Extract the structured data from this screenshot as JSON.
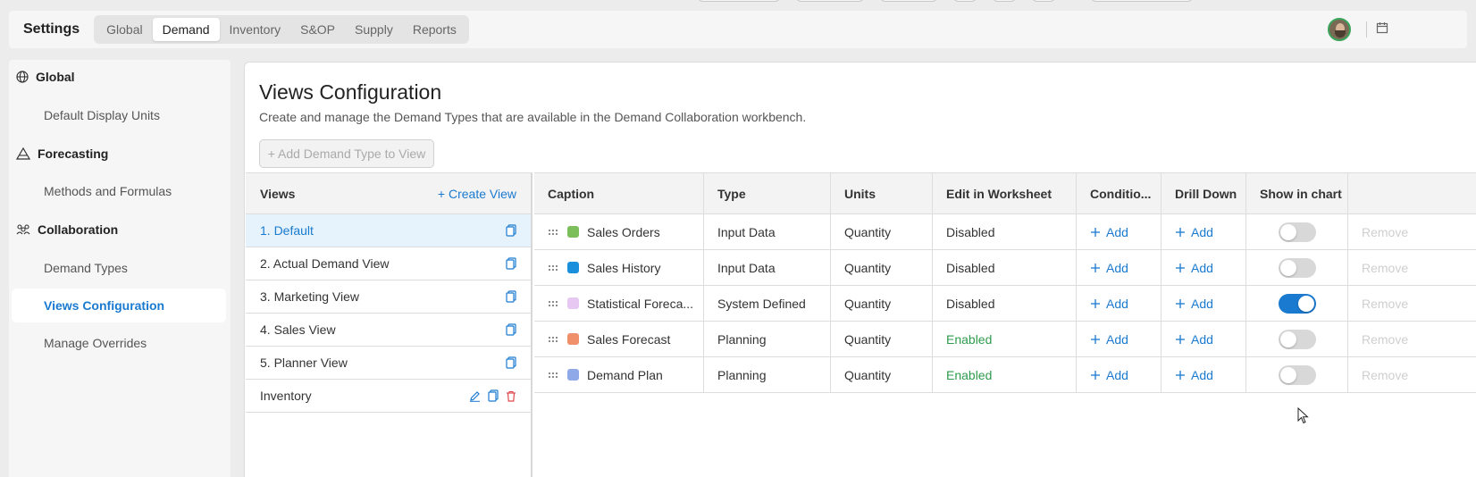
{
  "header": {
    "title": "Settings",
    "tabs": [
      "Global",
      "Demand",
      "Inventory",
      "S&OP",
      "Supply",
      "Reports"
    ],
    "active_tab": "Demand"
  },
  "sidebar": {
    "sections": [
      {
        "label": "Global",
        "icon": "globe-icon",
        "items": [
          "Default Display Units"
        ]
      },
      {
        "label": "Forecasting",
        "icon": "forecast-icon",
        "items": [
          "Methods and Formulas"
        ]
      },
      {
        "label": "Collaboration",
        "icon": "people-icon",
        "items": [
          "Demand Types",
          "Views Configuration",
          "Manage Overrides"
        ]
      }
    ],
    "active_item": "Views Configuration"
  },
  "main": {
    "title": "Views Configuration",
    "subtitle": "Create and manage the Demand Types that are available in the Demand Collaboration workbench.",
    "add_button": "+ Add Demand Type to View"
  },
  "views": {
    "header": "Views",
    "create_label": "+ Create View",
    "items": [
      "1. Default",
      "2. Actual Demand View",
      "3. Marketing View",
      "4. Sales View",
      "5. Planner View",
      "Inventory"
    ],
    "active_index": 0
  },
  "grid": {
    "columns": [
      "Caption",
      "Type",
      "Units",
      "Edit in Worksheet",
      "Conditio...",
      "Drill Down",
      "Show in chart",
      ""
    ],
    "add_label": "Add",
    "remove_label": "Remove",
    "rows": [
      {
        "caption": "Sales Orders",
        "color": "#7cbf5a",
        "type": "Input Data",
        "units": "Quantity",
        "edit": "Disabled",
        "chart": false
      },
      {
        "caption": "Sales History",
        "color": "#1a8fdc",
        "type": "Input Data",
        "units": "Quantity",
        "edit": "Disabled",
        "chart": false
      },
      {
        "caption": "Statistical Foreca...",
        "color": "#e6c8f2",
        "type": "System Defined",
        "units": "Quantity",
        "edit": "Disabled",
        "chart": true
      },
      {
        "caption": "Sales Forecast",
        "color": "#f0906a",
        "type": "Planning",
        "units": "Quantity",
        "edit": "Enabled",
        "chart": false
      },
      {
        "caption": "Demand Plan",
        "color": "#8fa8e8",
        "type": "Planning",
        "units": "Quantity",
        "edit": "Enabled",
        "chart": false
      }
    ]
  }
}
